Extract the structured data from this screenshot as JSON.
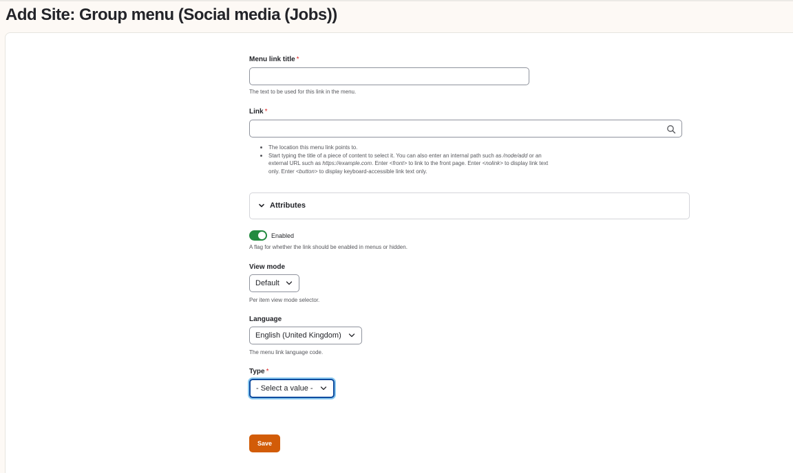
{
  "page": {
    "title": "Add Site: Group menu (Social media (Jobs))"
  },
  "form": {
    "menu_link_title": {
      "label": "Menu link title",
      "required_mark": "*",
      "value": "",
      "description": "The text to be used for this link in the menu."
    },
    "link": {
      "label": "Link",
      "required_mark": "*",
      "value": "",
      "icon": "search-icon",
      "help": [
        {
          "parts": [
            {
              "text": "The location this menu link points to.",
              "em": false
            }
          ]
        },
        {
          "parts": [
            {
              "text": "Start typing the title of a piece of content to select it. You can also enter an internal path such as ",
              "em": false
            },
            {
              "text": "/node/add",
              "em": true
            },
            {
              "text": " or an external URL such as ",
              "em": false
            },
            {
              "text": "https://example.com",
              "em": true
            },
            {
              "text": ". Enter ",
              "em": false
            },
            {
              "text": "<front>",
              "em": true
            },
            {
              "text": " to link to the front page. Enter ",
              "em": false
            },
            {
              "text": "<nolink>",
              "em": true
            },
            {
              "text": " to display link text only. Enter ",
              "em": false
            },
            {
              "text": "<button>",
              "em": true
            },
            {
              "text": " to display keyboard-accessible link text only.",
              "em": false
            }
          ]
        }
      ]
    },
    "attributes": {
      "label": "Attributes",
      "icon": "chevron-down-icon",
      "expanded": false
    },
    "enabled": {
      "label": "Enabled",
      "checked": true,
      "description": "A flag for whether the link should be enabled in menus or hidden."
    },
    "view_mode": {
      "label": "View mode",
      "selected": "Default",
      "description": "Per item view mode selector."
    },
    "language": {
      "label": "Language",
      "selected": "English (United Kingdom)",
      "description": "The menu link language code."
    },
    "type": {
      "label": "Type",
      "required_mark": "*",
      "selected": "- Select a value -"
    },
    "save_label": "Save"
  },
  "colors": {
    "accent_save": "#d25c08",
    "toggle_on": "#228a3f",
    "required": "#dc2323",
    "focus": "#0d4a9e"
  }
}
